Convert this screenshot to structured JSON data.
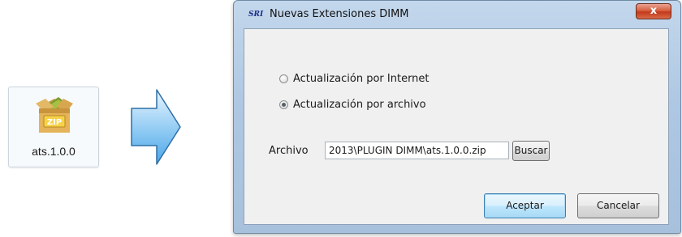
{
  "file_tile": {
    "label": "ats.1.0.0",
    "icon": "zip-archive-icon",
    "badge": "ZIP"
  },
  "arrow": {
    "icon": "right-arrow-icon",
    "color": "#4aa6e8"
  },
  "dialog": {
    "app_icon_text": "SRI",
    "title": "Nuevas Extensiones DIMM",
    "close_label": "x",
    "options": [
      {
        "label": "Actualización por Internet",
        "checked": false
      },
      {
        "label": "Actualización por archivo",
        "checked": true
      }
    ],
    "file_label": "Archivo",
    "file_value": "2013\\PLUGIN DIMM\\ats.1.0.0.zip",
    "browse_label": "Buscar",
    "accept_label": "Aceptar",
    "cancel_label": "Cancelar"
  }
}
